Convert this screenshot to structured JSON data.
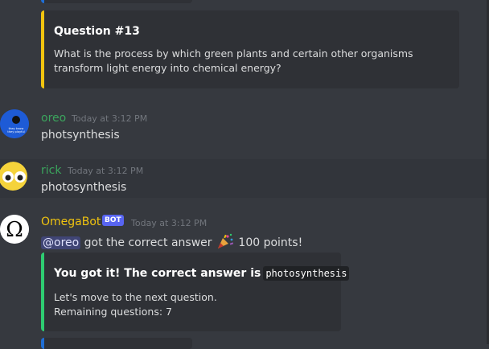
{
  "question_embed": {
    "title": "Question #13",
    "body": "What is the process by which green plants and certain other organisms transform light energy into chemical energy?",
    "accent_color": "#f1c40f"
  },
  "messages": [
    {
      "username": "oreo",
      "username_color": "#3ba55d",
      "timestamp": "Today at 3:12 PM",
      "content": "photsynthesis",
      "avatar_text": "they know they playful"
    },
    {
      "username": "rick",
      "username_color": "#3ba55d",
      "timestamp": "Today at 3:12 PM",
      "content": "photosynthesis",
      "avatar_icon": "emoji-face-icon"
    },
    {
      "username": "OmegaBot",
      "username_color": "#f1c40f",
      "bot_tag": "BOT",
      "timestamp": "Today at 3:12 PM",
      "mention": "@oreo",
      "content_text": " got the correct answer",
      "content_points": " 100 points!",
      "avatar_icon": "omega-icon"
    }
  ],
  "answer_embed": {
    "title": "You got it! The correct answer is",
    "answer": "photosynthesis",
    "line1": "Let's move to the next question.",
    "line2": "Remaining questions: 7",
    "accent_color": "#2ecc71"
  }
}
